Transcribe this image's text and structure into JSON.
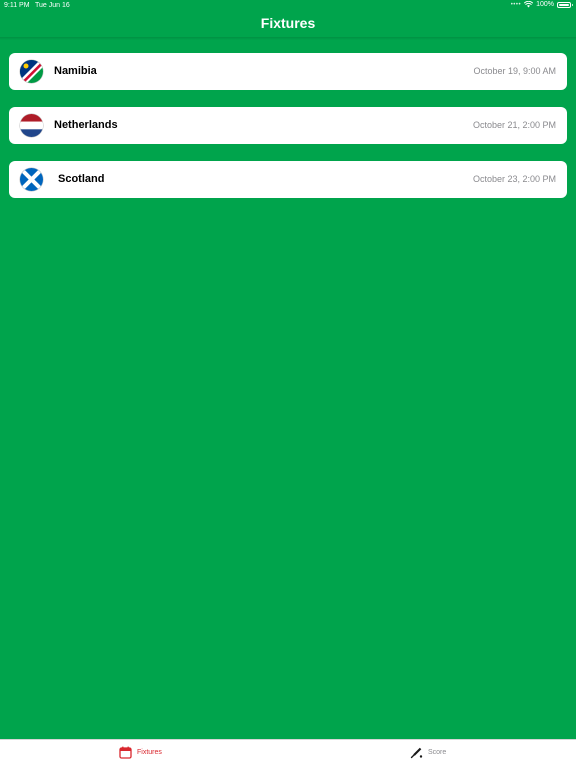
{
  "status_bar": {
    "time": "9:11 PM",
    "date": "Tue Jun 16",
    "battery": "100%"
  },
  "nav": {
    "title": "Fixtures"
  },
  "fixtures": [
    {
      "team": "Namibia",
      "date": "October 19, 9:00 AM",
      "flag_icon": "namibia-flag-icon"
    },
    {
      "team": "Netherlands",
      "date": "October 21, 2:00 PM",
      "flag_icon": "netherlands-flag-icon"
    },
    {
      "team": "Scotland",
      "date": "October 23, 2:00 PM",
      "flag_icon": "scotland-flag-icon"
    }
  ],
  "tabs": [
    {
      "label": "Fixtures",
      "icon": "calendar-icon",
      "selected": true
    },
    {
      "label": "Score",
      "icon": "cricket-bat-icon",
      "selected": false
    }
  ],
  "colors": {
    "background": "#00a44c",
    "card": "#ffffff",
    "tab_active": "#d9272e",
    "tab_inactive": "#8a8a8e"
  }
}
